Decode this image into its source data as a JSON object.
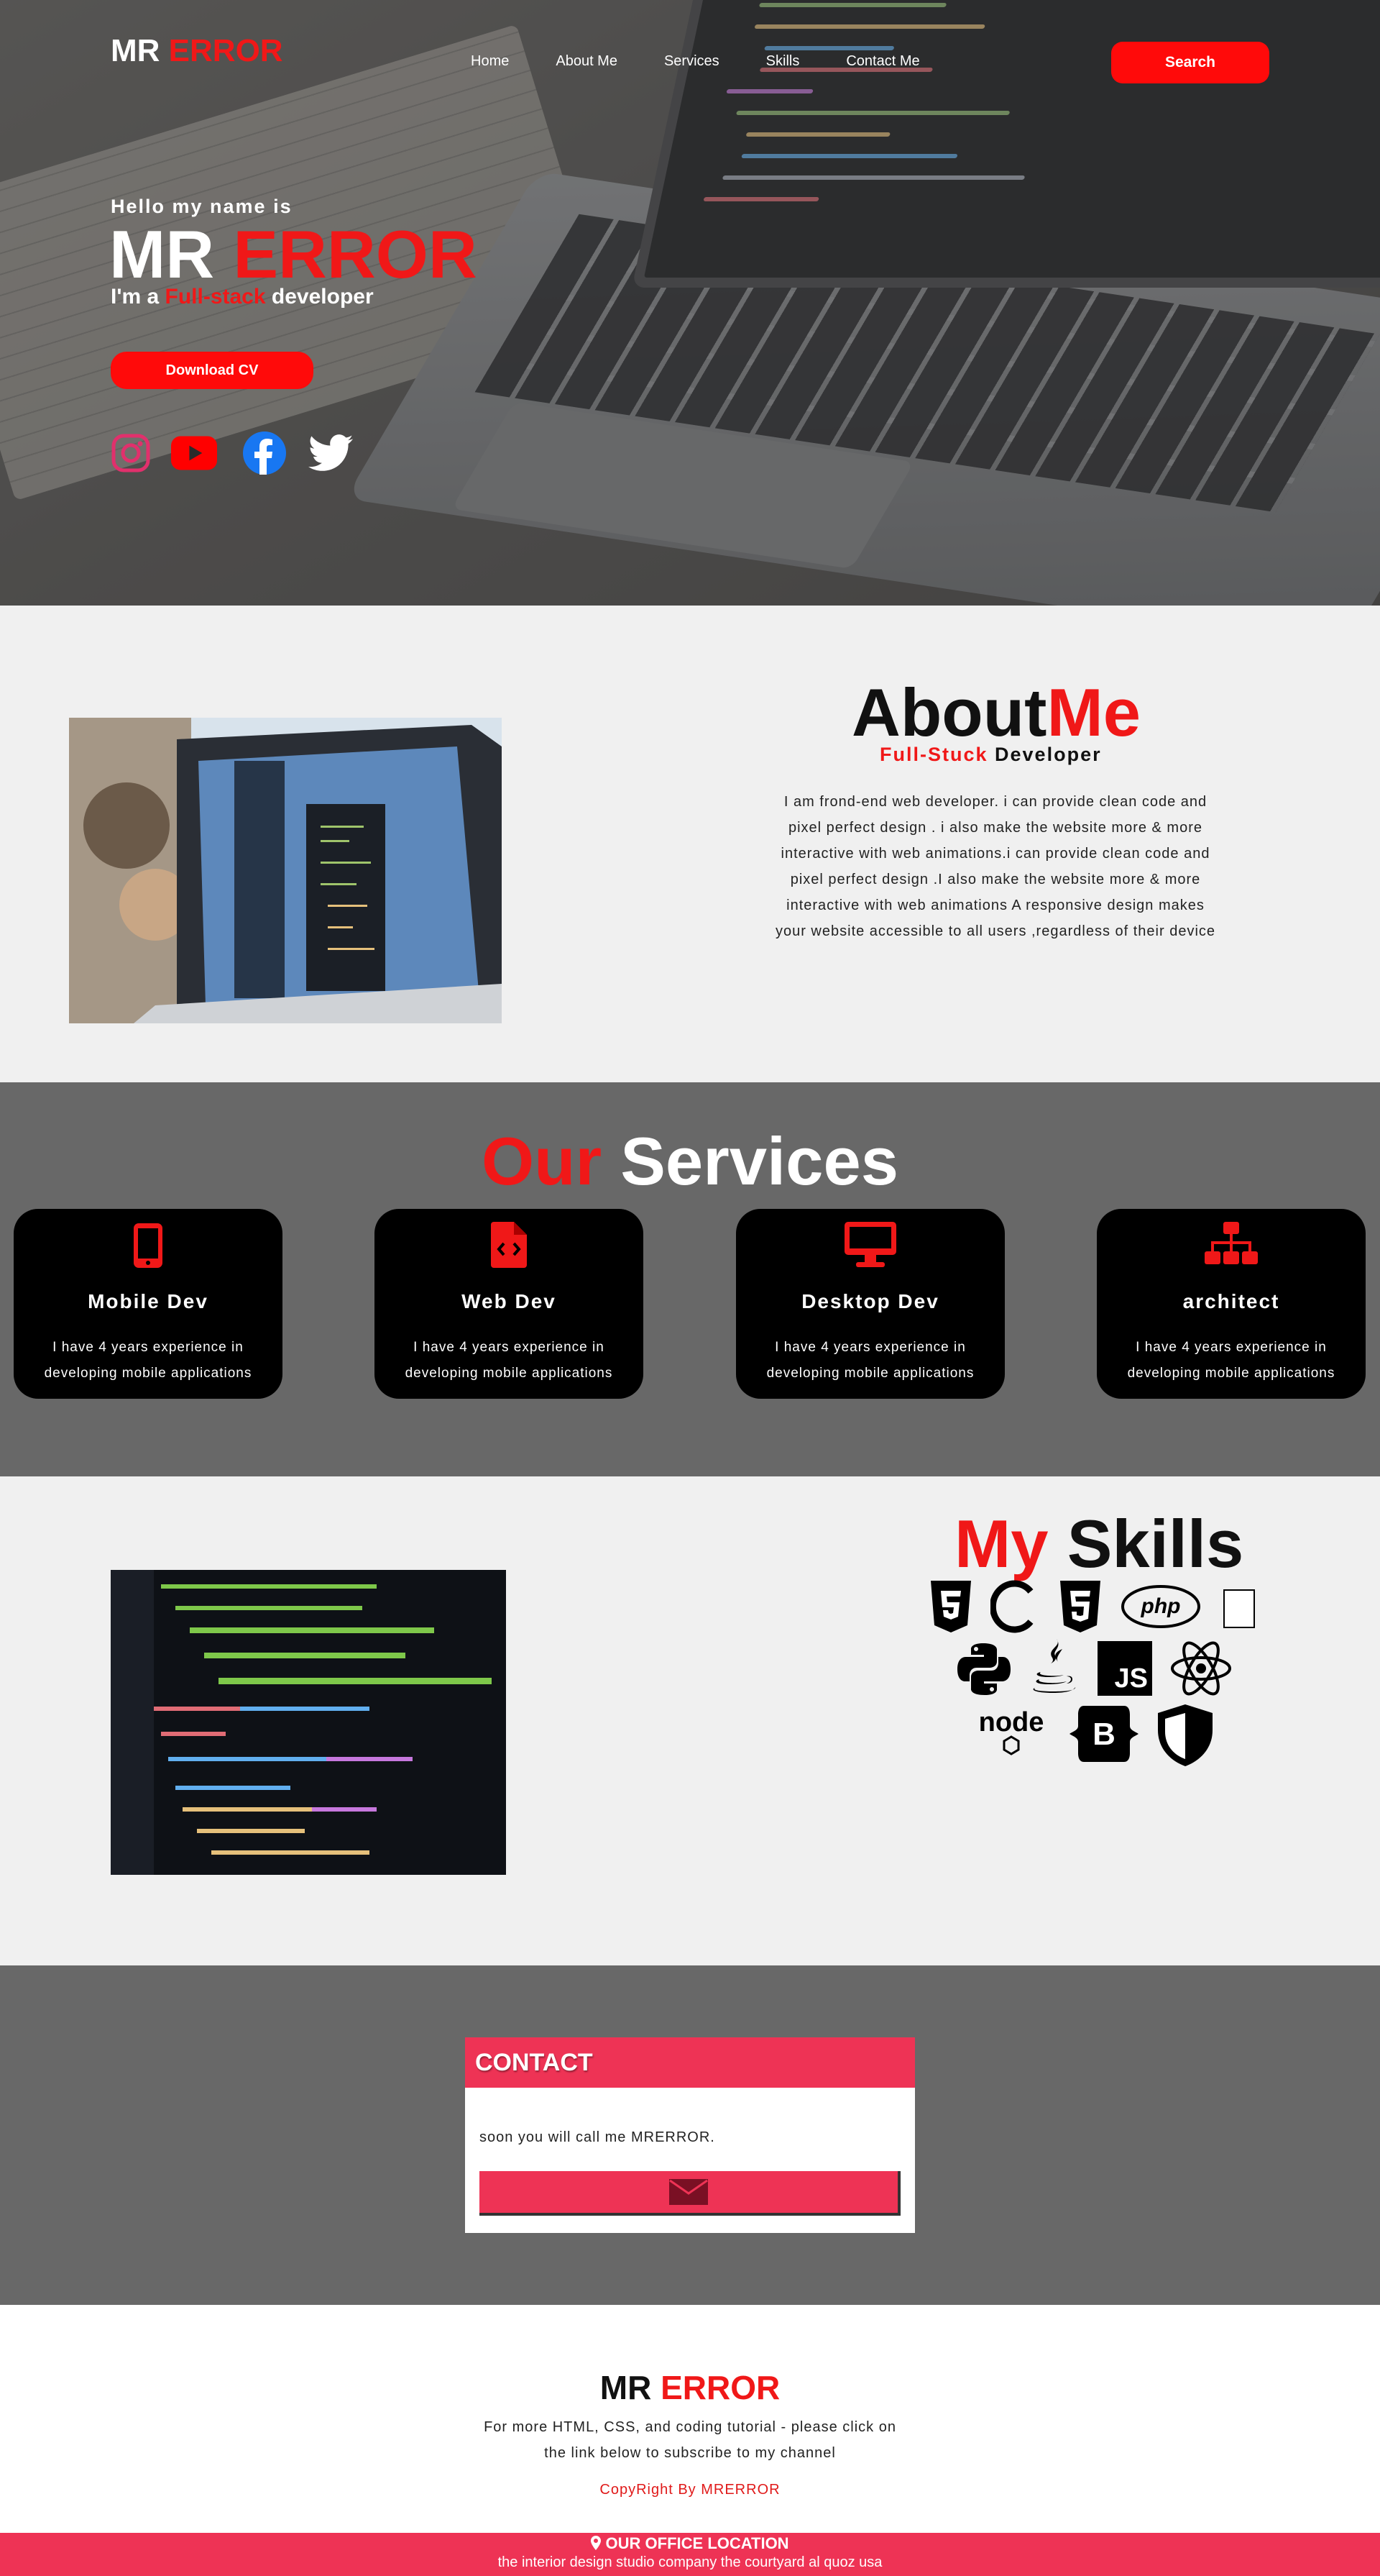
{
  "brand": {
    "first": "MR",
    "second": "ERROR"
  },
  "nav": {
    "items": [
      "Home",
      "About Me",
      "Services",
      "Skills",
      "Contact Me"
    ],
    "search_label": "Search"
  },
  "hero": {
    "greeting": "Hello my name is",
    "name_first": "MR",
    "name_second": "ERROR",
    "role_prefix": "I'm a",
    "role_highlight": "Full-stack",
    "role_suffix": "developer",
    "cv_label": "Download CV",
    "socials": [
      "instagram-icon",
      "youtube-icon",
      "facebook-icon",
      "twitter-icon"
    ]
  },
  "about": {
    "title_a": "About",
    "title_b": "Me",
    "sub_highlight": "Full-Stuck",
    "sub_rest": "Developer",
    "text": "I am frond-end web developer. i can provide clean code and pixel perfect design . i also make the website more & more interactive with web animations.i can provide clean code and pixel perfect design .I also make the website more & more interactive with web animations A responsive design makes your website accessible to all users ,regardless of their device"
  },
  "services": {
    "title_a": "Our",
    "title_b": "Services",
    "cards": [
      {
        "icon": "mobile-icon",
        "title": "Mobile Dev",
        "desc": "I have 4 years experience in developing mobile applications"
      },
      {
        "icon": "file-code-icon",
        "title": "Web Dev",
        "desc": "I have 4 years experience in developing mobile applications"
      },
      {
        "icon": "desktop-icon",
        "title": "Desktop Dev",
        "desc": "I have 4 years experience in developing mobile applications"
      },
      {
        "icon": "sitemap-icon",
        "title": "architect",
        "desc": "I have 4 years experience in developing mobile applications"
      }
    ]
  },
  "skills": {
    "title_a": "My",
    "title_b": "Skills",
    "icons": [
      "css3-icon",
      "c-icon",
      "html5-icon",
      "php-icon",
      "broken-icon",
      "python-icon",
      "java-icon",
      "js-icon",
      "react-icon",
      "nodejs-icon",
      "bootstrap-icon",
      "shield-icon"
    ],
    "labels": {
      "php": "php",
      "js": "JS",
      "bootstrap": "B",
      "node": "node"
    }
  },
  "contact": {
    "header": "CONTACT",
    "text": "soon you will call me MRERROR.",
    "button_icon": "envelope-icon"
  },
  "footer": {
    "logo_first": "MR",
    "logo_second": "ERROR",
    "text": "For more HTML, CSS, and coding tutorial - please click on the link below to subscribe to my channel",
    "copyright": "CopyRight By MRERROR",
    "office_title": "OUR OFFICE LOCATION",
    "office_address": "the interior design studio company the courtyard al quoz usa"
  },
  "colors": {
    "accent": "#f01818",
    "contact_red": "#ee3355",
    "dark_band": "#686868",
    "light_band": "#f0f0f0"
  }
}
